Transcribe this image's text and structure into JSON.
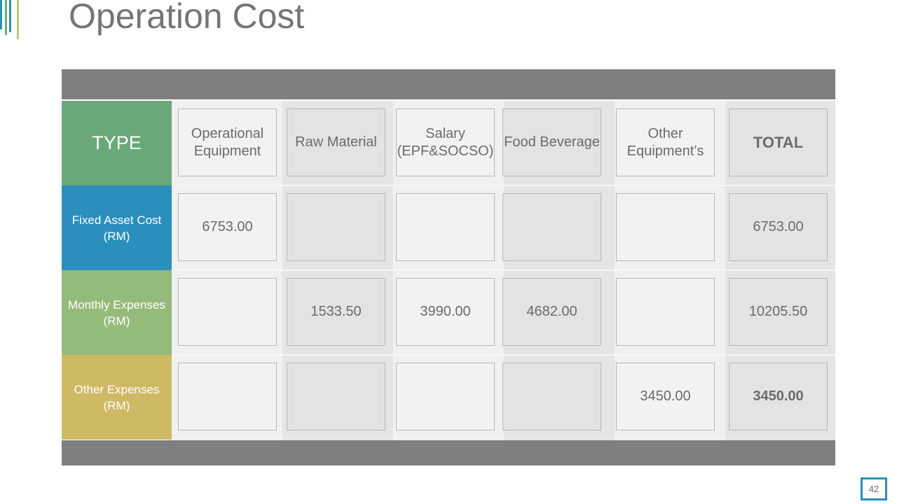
{
  "title": "Operation Cost",
  "page_number": "42",
  "colors": {
    "band": "#7f7f7f",
    "type": "#6aa879",
    "fixed": "#2a8fbd",
    "monthly": "#95bb7a",
    "other": "#cfb964"
  },
  "table": {
    "header": {
      "type_label": "TYPE",
      "columns": [
        "Operational Equipment",
        "Raw Material",
        "Salary (EPF&SOCSO)",
        "Food Beverage",
        "Other Equipment’s",
        "TOTAL"
      ]
    },
    "rows": [
      {
        "label": "Fixed Asset Cost (RM)",
        "values": [
          "6753.00",
          "",
          "",
          "",
          "",
          "6753.00"
        ]
      },
      {
        "label": "Monthly Expenses (RM)",
        "values": [
          "",
          "1533.50",
          "3990.00",
          "4682.00",
          "",
          "10205.50"
        ]
      },
      {
        "label": "Other Expenses (RM)",
        "values": [
          "",
          "",
          "",
          "",
          "3450.00",
          "3450.00"
        ]
      }
    ]
  }
}
